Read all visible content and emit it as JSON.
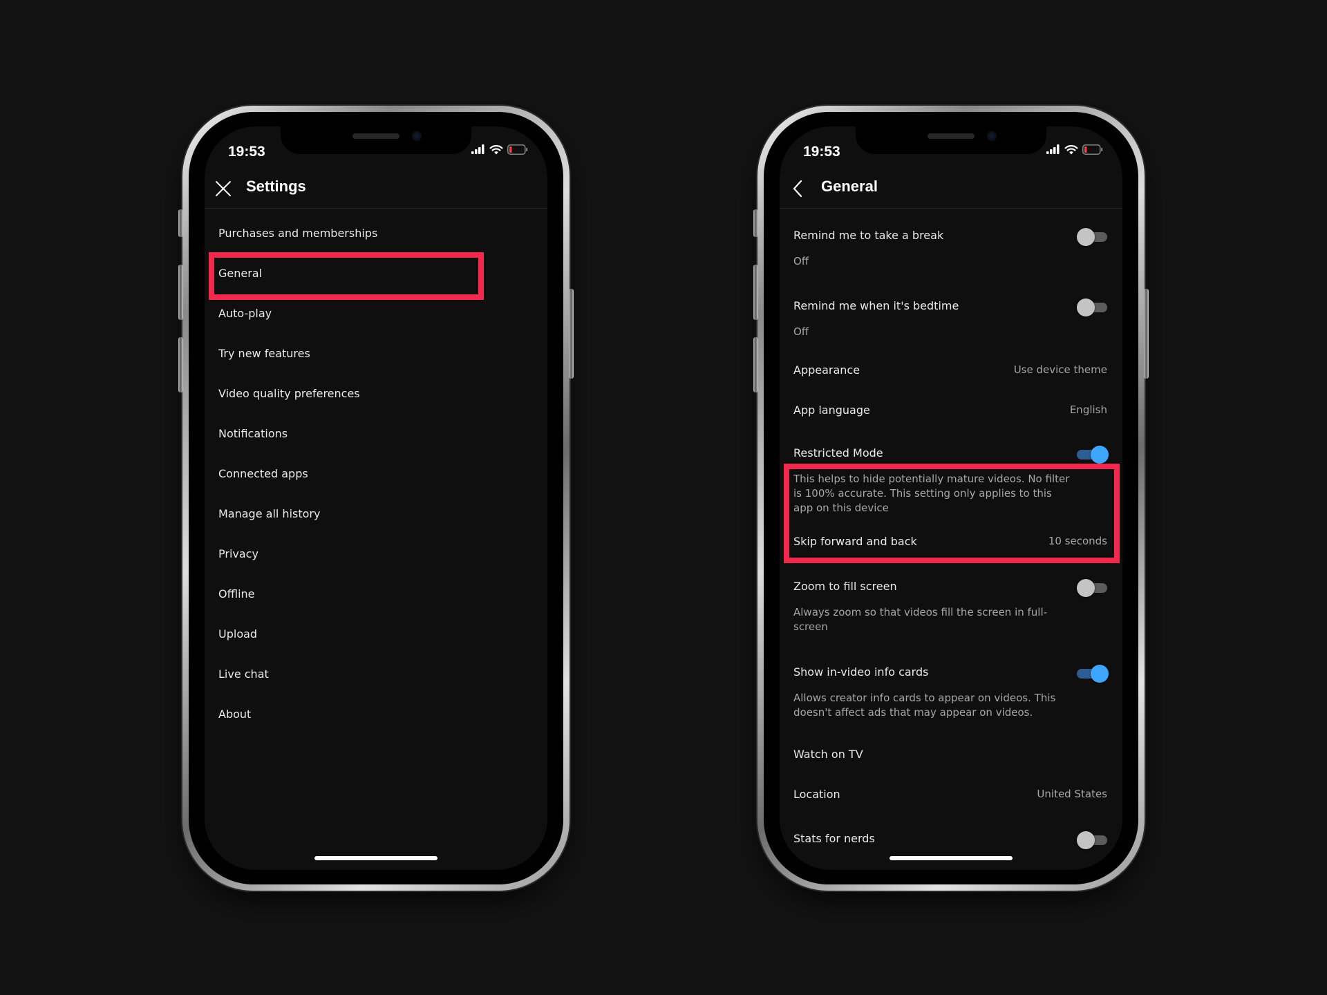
{
  "colors": {
    "background": "#131313",
    "screen": "#0f0f0f",
    "highlight": "#f2284d",
    "toggle_on": "#3ea6ff",
    "toggle_on_track": "#2d5d93",
    "toggle_off": "#c4c4c4",
    "battery_low": "#ff3b30"
  },
  "left_screen": {
    "status_time": "19:53",
    "appbar": {
      "title": "Settings",
      "nav_icon": "close-icon"
    },
    "menu": [
      "Purchases and memberships",
      "General",
      "Auto-play",
      "Try new features",
      "Video quality preferences",
      "Notifications",
      "Connected apps",
      "Manage all history",
      "Privacy",
      "Offline",
      "Upload",
      "Live chat",
      "About"
    ],
    "highlighted_item": "General"
  },
  "right_screen": {
    "status_time": "19:53",
    "appbar": {
      "title": "General",
      "nav_icon": "back-arrow-icon"
    },
    "settings": {
      "take_break": {
        "label": "Remind me to take a break",
        "sub": "Off",
        "toggle": "off"
      },
      "bedtime": {
        "label": "Remind me when it's bedtime",
        "sub": "Off",
        "toggle": "off"
      },
      "appearance": {
        "label": "Appearance",
        "value": "Use device theme"
      },
      "app_language": {
        "label": "App language",
        "value": "English"
      },
      "restricted_mode": {
        "label": "Restricted Mode",
        "sub": "This helps to hide potentially mature videos. No filter is 100% accurate. This setting only applies to this app on this device",
        "toggle": "on"
      },
      "skip": {
        "label": "Skip forward and back",
        "value": "10 seconds"
      },
      "zoom": {
        "label": "Zoom to fill screen",
        "sub": "Always zoom so that videos fill the screen in full-screen",
        "toggle": "off"
      },
      "info_cards": {
        "label": "Show in-video info cards",
        "sub": "Allows creator info cards to appear on videos. This doesn't affect ads that may appear on videos.",
        "toggle": "on"
      },
      "watch_tv": {
        "label": "Watch on TV"
      },
      "location": {
        "label": "Location",
        "value": "United States"
      },
      "stats": {
        "label": "Stats for nerds",
        "toggle": "off"
      }
    },
    "highlighted_item": "Restricted Mode"
  }
}
